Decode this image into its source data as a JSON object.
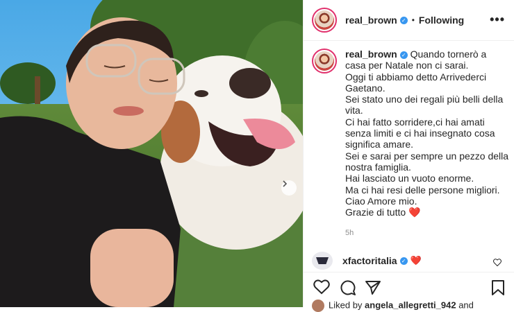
{
  "header": {
    "username": "real_brown",
    "separator": "•",
    "follow_status": "Following",
    "more_label": "•••"
  },
  "caption": {
    "username": "real_brown",
    "lines": [
      "Quando tornerò a casa per Natale non ci sarai.",
      "Oggi ti abbiamo detto Arrivederci Gaetano.",
      "Sei stato uno dei regali più belli della vita.",
      "Ci hai fatto sorridere,ci hai amati senza limiti e ci hai insegnato cosa significa amare.",
      "Sei e sarai per sempre un pezzo della nostra famiglia.",
      "Hai lasciato un vuoto enorme.",
      "Ma ci hai resi delle persone migliori.",
      "Ciao Amore mio.",
      "Grazie di tutto ❤️"
    ],
    "time": "5h"
  },
  "comment": {
    "username": "xfactoritalia",
    "heart": "❤️"
  },
  "likes": {
    "prefix": "Liked by",
    "user": "angela_allegretti_942",
    "suffix": "and"
  },
  "icons": {
    "verified": "verified-badge-icon",
    "more": "more-options-icon",
    "next": "chevron-right-icon",
    "like": "heart-icon",
    "comment": "comment-icon",
    "share": "share-icon",
    "save": "bookmark-icon"
  },
  "colors": {
    "verified": "#3897f0",
    "heart": "#ed4956",
    "text": "#262626",
    "muted": "#8e8e8e"
  }
}
